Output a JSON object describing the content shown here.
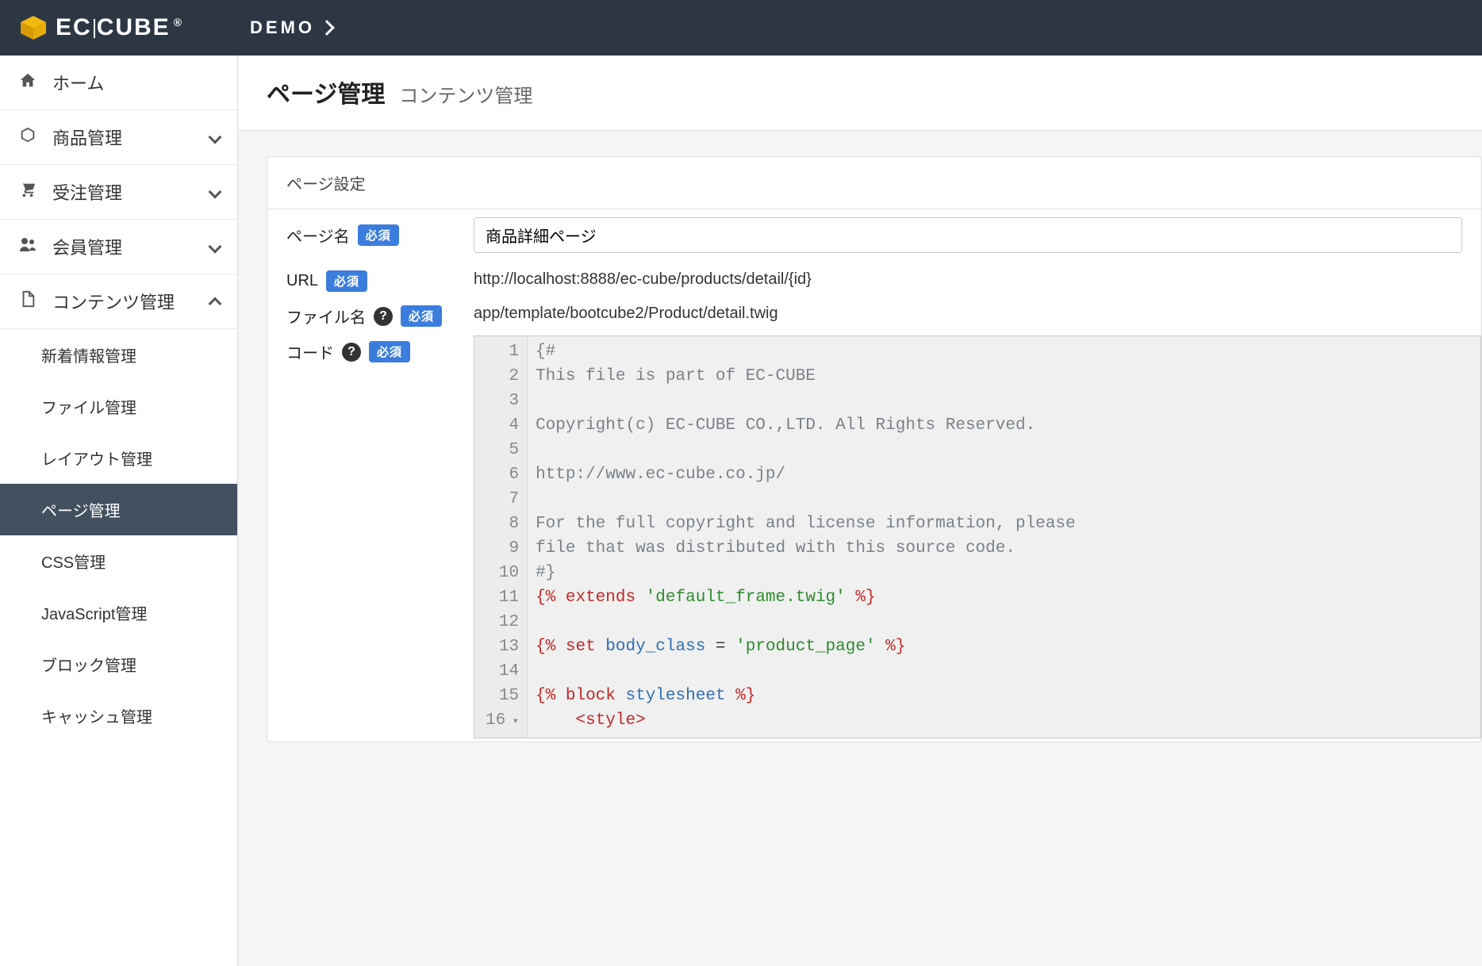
{
  "header": {
    "logo_text_a": "EC",
    "logo_text_b": "CUBE",
    "logo_tm": "®",
    "demo_label": "DEMO"
  },
  "sidebar": {
    "items": [
      {
        "icon": "home",
        "label": "ホーム",
        "expandable": false
      },
      {
        "icon": "cube",
        "label": "商品管理",
        "expandable": true,
        "expanded": false
      },
      {
        "icon": "cart",
        "label": "受注管理",
        "expandable": true,
        "expanded": false
      },
      {
        "icon": "users",
        "label": "会員管理",
        "expandable": true,
        "expanded": false
      },
      {
        "icon": "file",
        "label": "コンテンツ管理",
        "expandable": true,
        "expanded": true
      }
    ],
    "subitems": [
      {
        "label": "新着情報管理",
        "active": false
      },
      {
        "label": "ファイル管理",
        "active": false
      },
      {
        "label": "レイアウト管理",
        "active": false
      },
      {
        "label": "ページ管理",
        "active": true
      },
      {
        "label": "CSS管理",
        "active": false
      },
      {
        "label": "JavaScript管理",
        "active": false
      },
      {
        "label": "ブロック管理",
        "active": false
      },
      {
        "label": "キャッシュ管理",
        "active": false
      }
    ]
  },
  "page": {
    "title": "ページ管理",
    "subtitle": "コンテンツ管理",
    "card_title": "ページ設定",
    "labels": {
      "page_name": "ページ名",
      "url": "URL",
      "file_name": "ファイル名",
      "code": "コード",
      "required": "必須",
      "help": "?"
    },
    "values": {
      "page_name": "商品詳細ページ",
      "url": "http://localhost:8888/ec-cube/products/detail/{id}",
      "file_name": "app/template/bootcube2/Product/detail.twig"
    }
  },
  "code": {
    "lines": [
      {
        "n": 1,
        "segments": [
          {
            "t": "{#",
            "c": "tk-comment"
          }
        ]
      },
      {
        "n": 2,
        "segments": [
          {
            "t": "This file is part of EC-CUBE",
            "c": "tk-comment"
          }
        ]
      },
      {
        "n": 3,
        "segments": [
          {
            "t": "",
            "c": "tk-comment"
          }
        ]
      },
      {
        "n": 4,
        "segments": [
          {
            "t": "Copyright(c) EC-CUBE CO.,LTD. All Rights Reserved.",
            "c": "tk-comment"
          }
        ]
      },
      {
        "n": 5,
        "segments": [
          {
            "t": "",
            "c": "tk-comment"
          }
        ]
      },
      {
        "n": 6,
        "segments": [
          {
            "t": "http://www.ec-cube.co.jp/",
            "c": "tk-comment"
          }
        ]
      },
      {
        "n": 7,
        "segments": [
          {
            "t": "",
            "c": "tk-comment"
          }
        ]
      },
      {
        "n": 8,
        "segments": [
          {
            "t": "For the full copyright and license information, please",
            "c": "tk-comment"
          }
        ]
      },
      {
        "n": 9,
        "segments": [
          {
            "t": "file that was distributed with this source code.",
            "c": "tk-comment"
          }
        ]
      },
      {
        "n": 10,
        "segments": [
          {
            "t": "#}",
            "c": "tk-comment"
          }
        ]
      },
      {
        "n": 11,
        "segments": [
          {
            "t": "{% ",
            "c": "tk-delim"
          },
          {
            "t": "extends",
            "c": "tk-key"
          },
          {
            "t": " ",
            "c": ""
          },
          {
            "t": "'default_frame.twig'",
            "c": "tk-str"
          },
          {
            "t": " %}",
            "c": "tk-delim"
          }
        ]
      },
      {
        "n": 12,
        "segments": [
          {
            "t": "",
            "c": ""
          }
        ]
      },
      {
        "n": 13,
        "segments": [
          {
            "t": "{% ",
            "c": "tk-delim"
          },
          {
            "t": "set",
            "c": "tk-key"
          },
          {
            "t": " ",
            "c": ""
          },
          {
            "t": "body_class",
            "c": "tk-var"
          },
          {
            "t": " = ",
            "c": "tk-op"
          },
          {
            "t": "'product_page'",
            "c": "tk-str"
          },
          {
            "t": " %}",
            "c": "tk-delim"
          }
        ]
      },
      {
        "n": 14,
        "segments": [
          {
            "t": "",
            "c": ""
          }
        ]
      },
      {
        "n": 15,
        "segments": [
          {
            "t": "{% ",
            "c": "tk-delim"
          },
          {
            "t": "block",
            "c": "tk-key"
          },
          {
            "t": " ",
            "c": ""
          },
          {
            "t": "stylesheet",
            "c": "tk-var"
          },
          {
            "t": " %}",
            "c": "tk-delim"
          }
        ]
      },
      {
        "n": 16,
        "fold": true,
        "segments": [
          {
            "t": "    ",
            "c": ""
          },
          {
            "t": "<style>",
            "c": "tk-tag"
          }
        ]
      }
    ]
  }
}
